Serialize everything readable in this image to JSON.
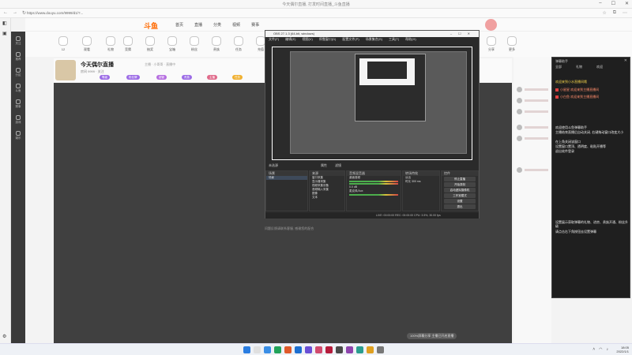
{
  "browser": {
    "title": "今天偶尔直播, 打发时间直播_斗鱼直播",
    "url": "https://www.douyu.com/9999/d1/?...",
    "nav_back": "←",
    "nav_forward": "→",
    "nav_refresh": "↻",
    "window_minimize": "–",
    "window_maximize": "☐",
    "window_close": "✕"
  },
  "site": {
    "logo": "斗鱼",
    "nav": [
      "首页",
      "直播",
      "分类",
      "视频",
      "赛事"
    ],
    "left_nav": [
      "关注",
      "推荐",
      "分区",
      "斗鱼",
      "赛事",
      "游戏",
      "娱乐"
    ]
  },
  "toolbar": {
    "items": [
      {
        "label": "12",
        "icon": "level-icon"
      },
      {
        "label": "观看",
        "icon": "eye-icon"
      },
      {
        "label": "礼物",
        "icon": "gift-icon"
      },
      {
        "label": "竞猜",
        "icon": "trophy-icon"
      },
      {
        "label": "抽奖",
        "icon": "ticket-icon"
      },
      {
        "label": "宝箱",
        "icon": "chest-icon"
      },
      {
        "label": "粉丝",
        "icon": "heart-icon"
      },
      {
        "label": "贵族",
        "icon": "crown-icon"
      },
      {
        "label": "任务",
        "icon": "list-icon"
      },
      {
        "label": "充值",
        "icon": "coin-icon"
      },
      {
        "label": "分享",
        "icon": "share-icon"
      },
      {
        "label": "更多",
        "icon": "more-icon"
      }
    ]
  },
  "room": {
    "title": "今天偶尔直播",
    "meta": "主播 · 小哥哥 · 直播中",
    "sub": "房间 9999 · 关注",
    "badges": [
      {
        "label": "等级",
        "color": "#9c6ce6"
      },
      {
        "label": "粉丝牌",
        "color": "#9c6ce6"
      },
      {
        "label": "超管",
        "color": "#b56de0"
      },
      {
        "label": "贵族",
        "color": "#9c6ce6"
      },
      {
        "label": "主播",
        "color": "#e06a8a"
      },
      {
        "label": "任务",
        "color": "#f0b030"
      }
    ]
  },
  "obs": {
    "title": "OBS 27.1.3 (64-bit, windows)",
    "menu": [
      "文件(F)",
      "编辑(E)",
      "视图(V)",
      "停靠窗口(D)",
      "配置文件(P)",
      "场景集合(S)",
      "工具(T)",
      "帮助(H)"
    ],
    "controls": {
      "label": "未选源",
      "prop": "属性",
      "filter": "滤镜"
    },
    "scenes": {
      "header": "场景",
      "items": [
        "场景"
      ]
    },
    "sources": {
      "header": "来源",
      "items": [
        "窗口采集",
        "显示器采集",
        "视频采集设备",
        "音频输入采集",
        "图像",
        "文本"
      ]
    },
    "mixer": {
      "header": "音频混音器",
      "items": [
        "桌面音频",
        "麦克风/Aux"
      ],
      "db": "0.0 dB"
    },
    "transitions": {
      "header": "转场特效",
      "value": "淡出",
      "duration_label": "时长",
      "duration": "300 ms"
    },
    "controls_dock": {
      "header": "控件",
      "buttons": [
        "停止直播",
        "开始录制",
        "启动虚拟摄像机",
        "工作室模式",
        "设置",
        "退出"
      ]
    },
    "status": "LIVE: 00:00:00   REC: 00:00:00   CPU: 3.5%, 30.00 fps"
  },
  "video_hint": "问题反馈请联系客服, 感谢您的配合",
  "bottom_bubble": "100%屏幕分享 主播已开启直播",
  "overlay": {
    "header": "弹幕助手",
    "close": "✕",
    "tabs": [
      "全部",
      "礼物",
      "欢迎"
    ],
    "lines": [
      {
        "text": "欢迎来到小水直播间哦",
        "style": "yellow"
      },
      {
        "text": "小星星 欢迎来到主播直播间",
        "style": "red"
      },
      {
        "text": "小白鱼 欢迎来到主播直播间",
        "style": "red"
      },
      {
        "text": "欢迎使用斗鱼弹幕助手",
        "style": "normal"
      },
      {
        "text": "主播结束直播后自动关闭, 右键拖动窗口改变大小",
        "style": "normal"
      },
      {
        "text": "在上角关闭该窗口",
        "style": "normal"
      },
      {
        "text": "设置窗口置顶、透明度、粘贴开播等",
        "style": "normal"
      },
      {
        "text": "退出软件登录",
        "style": "normal"
      },
      {
        "text": "设置展示获取弹幕的礼物、进房、贵族开通、粉丝升级",
        "style": "normal"
      },
      {
        "text": "请点击右下角按钮去设置弹幕",
        "style": "normal"
      }
    ]
  },
  "taskbar": {
    "time": "18:05",
    "date": "2022/1/1",
    "apps": [
      "#2a7de1",
      "#e0e0e0",
      "#3a8ee6",
      "#22a35a",
      "#e05a2a",
      "#1d6fd1",
      "#6a4fd6",
      "#d14a6e",
      "#b51c3c",
      "#4a4a4a",
      "#8e44ad",
      "#2a9d8f",
      "#e0a020",
      "#777777"
    ]
  }
}
